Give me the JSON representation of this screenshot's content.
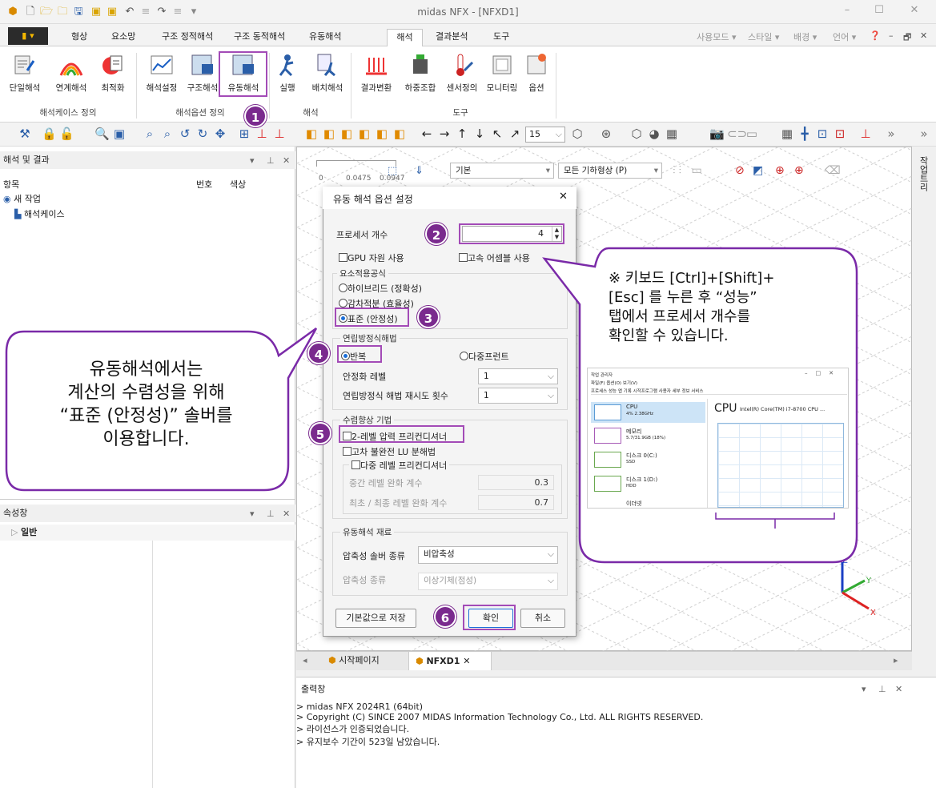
{
  "window": {
    "title": "midas NFX - [NFXD1]"
  },
  "menu": {
    "tabs": [
      "형상",
      "요소망",
      "구조 정적해석",
      "구조 동적해석",
      "유동해석",
      "해석",
      "결과분석",
      "도구"
    ],
    "right": [
      "사용모드",
      "스타일",
      "배경",
      "언어"
    ]
  },
  "ribbon": {
    "buttons": [
      "단일해석",
      "연계해석",
      "최적화",
      "해석설정",
      "구조해석",
      "유동해석",
      "실행",
      "배치해석",
      "결과변환",
      "하중조합",
      "센서정의",
      "모니터링",
      "옵션"
    ],
    "groups": [
      "해석케이스 정의",
      "해석옵션 정의",
      "해석",
      "도구"
    ]
  },
  "toolbar": {
    "zoom_value": "15"
  },
  "tree": {
    "header": "해석 및 결과",
    "col_item": "항목",
    "col_no": "번호",
    "col_color": "색상",
    "root": "새 작업",
    "child": "해석케이스"
  },
  "props": {
    "header": "속성창",
    "section": "일반"
  },
  "viewport": {
    "ruler": [
      "0",
      "0.0475",
      "0.0947"
    ],
    "combo1": "기본",
    "combo2": "모든 기하형상 (P)",
    "axes": {
      "z": "Z",
      "y": "Y",
      "x": "X"
    }
  },
  "right_strip": "작업트리",
  "doc_tabs": [
    "시작페이지",
    "NFXD1"
  ],
  "output": {
    "header": "출력창",
    "lines": [
      "> midas NFX 2024R1 (64bit)",
      "> Copyright (C) SINCE 2007 MIDAS Information Technology Co., Ltd. ALL RIGHTS RESERVED.",
      "> 라이선스가 인증되었습니다.",
      "> 유지보수 기간이 523일 남았습니다."
    ]
  },
  "dialog": {
    "title": "유동 해석 옵션 설정",
    "processor_label": "프로세서 개수",
    "processor_value": "4",
    "gpu": "GPU 자원 사용",
    "fast_assembly": "고속 어셈블 사용",
    "element_group": "요소적용공식",
    "opt_hybrid": "하이브리드 (정확성)",
    "opt_reduced": "감차적분 (효율성)",
    "opt_standard": "표준 (안정성)",
    "solver_group": "연립방정식해법",
    "opt_iter": "반복",
    "opt_multifront": "다중프런트",
    "stab_label": "안정화 레벨",
    "stab_value": "1",
    "retry_label": "연립방정식 해법 재시도 횟수",
    "retry_value": "1",
    "conv_group": "수렴향상 기법",
    "pc2": "2-레벨 압력 프리컨디셔너",
    "ilu": "고차 불완전 LU 분해법",
    "multilevel": "다중 레벨 프리컨디셔너",
    "mid_relax": "중간 레벨 완화 계수",
    "mid_relax_val": "0.3",
    "final_relax": "최초 / 최종 레벨 완화 계수",
    "final_relax_val": "0.7",
    "material_group": "유동해석 재료",
    "solver_type_label": "압축성 솔버 종류",
    "solver_type_value": "비압축성",
    "comp_type_label": "압축성 종류",
    "comp_type_value": "이상기체(점성)",
    "save_default": "기본값으로 저장",
    "ok": "확인",
    "cancel": "취소"
  },
  "badges": [
    "1",
    "2",
    "3",
    "4",
    "5",
    "6"
  ],
  "callout_left": {
    "lines": [
      "유동해석에서는",
      "계산의 수렴성을 위해",
      "“표준 (안정성)” 솔버를",
      "이용합니다."
    ]
  },
  "callout_right": {
    "lines": [
      "※ 키보드 [Ctrl]+[Shift]+",
      "[Esc] 를 누른 후 “성능”",
      "탭에서 프로세서 개수를",
      "확인할 수 있습니다."
    ],
    "tm": {
      "title": "작업 관리자",
      "menu": "파일(F)  옵션(O)  보기(V)",
      "tabs": "프로세스  성능  앱 기록  시작프로그램  사용자  세부 정보  서비스",
      "cpu": "CPU",
      "cpu_sub": "4% 2.38GHz",
      "cpu_name": "Intel(R) Core(TM) i7-8700 CPU ...",
      "mem": "메모리",
      "mem_sub": "5.7/31.9GB (18%)",
      "disk0": "디스크 0(C:)",
      "disk0_sub": "SSD",
      "disk1": "디스크 1(D:)",
      "disk1_sub": "HDD",
      "eth": "이더넷"
    }
  },
  "colors": {
    "accent": "#a34bb7",
    "badge": "#7a2a8e",
    "active_tab": "#1a6ed8"
  }
}
